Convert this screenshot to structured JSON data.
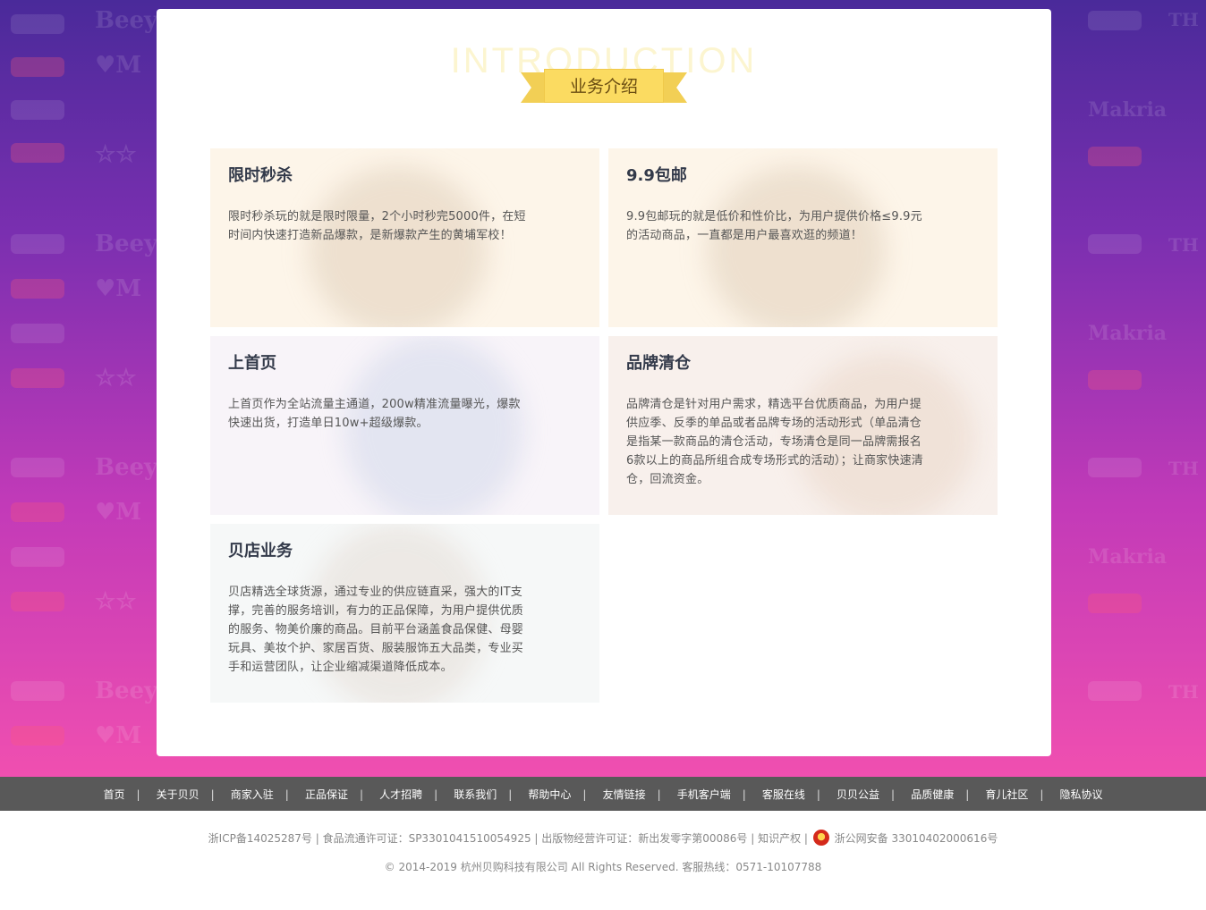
{
  "section": {
    "bg_title": "INTRODUCTION",
    "title": "业务介绍"
  },
  "cards": [
    {
      "title": "限时秒杀",
      "desc": "限时秒杀玩的就是限时限量，2个小时秒完5000件，在短时间内快速打造新品爆款，是新爆款产生的黄埔军校！"
    },
    {
      "title": "9.9包邮",
      "desc": "9.9包邮玩的就是低价和性价比，为用户提供价格≤9.9元的活动商品，一直都是用户最喜欢逛的频道！"
    },
    {
      "title": "上首页",
      "desc": "上首页作为全站流量主通道，200w精准流量曝光，爆款快速出货，打造单日10w+超级爆款。"
    },
    {
      "title": "品牌清仓",
      "desc": "品牌清仓是针对用户需求，精选平台优质商品，为用户提供应季、反季的单品或者品牌专场的活动形式（单品清仓是指某一款商品的清仓活动，专场清仓是同一品牌需报名6款以上的商品所组合成专场形式的活动）；让商家快速清仓，回流资金。"
    },
    {
      "title": "贝店业务",
      "desc": "贝店精选全球货源，通过专业的供应链直采，强大的IT支撑，完善的服务培训，有力的正品保障，为用户提供优质的服务、物美价廉的商品。目前平台涵盖食品保健、母婴玩具、美妆个护、家居百货、服装服饰五大品类，专业买手和运营团队，让企业缩减渠道降低成本。"
    }
  ],
  "footer": {
    "links": [
      "首页",
      "关于贝贝",
      "商家入驻",
      "正品保证",
      "人才招聘",
      "联系我们",
      "帮助中心",
      "友情链接",
      "手机客户端",
      "客服在线",
      "贝贝公益",
      "品质健康",
      "育儿社区",
      "隐私协议"
    ],
    "separator": "|",
    "license_text": "浙ICP备14025287号 | 食品流通许可证：SP3301041510054925 | 出版物经营许可证：新出发零字第00086号 | 知识产权 |",
    "police_text": "浙公网安备 33010402000616号",
    "copyright": "© 2014-2019 杭州贝购科技有限公司 All Rights Reserved. 客服热线：0571-10107788"
  },
  "colors": {
    "ribbon": "#fbdb61",
    "footer_bar": "#595959",
    "bg_top": "#4a2a9a",
    "bg_bottom": "#f04fb0"
  },
  "icons": {
    "police_badge": "police-badge-icon"
  }
}
